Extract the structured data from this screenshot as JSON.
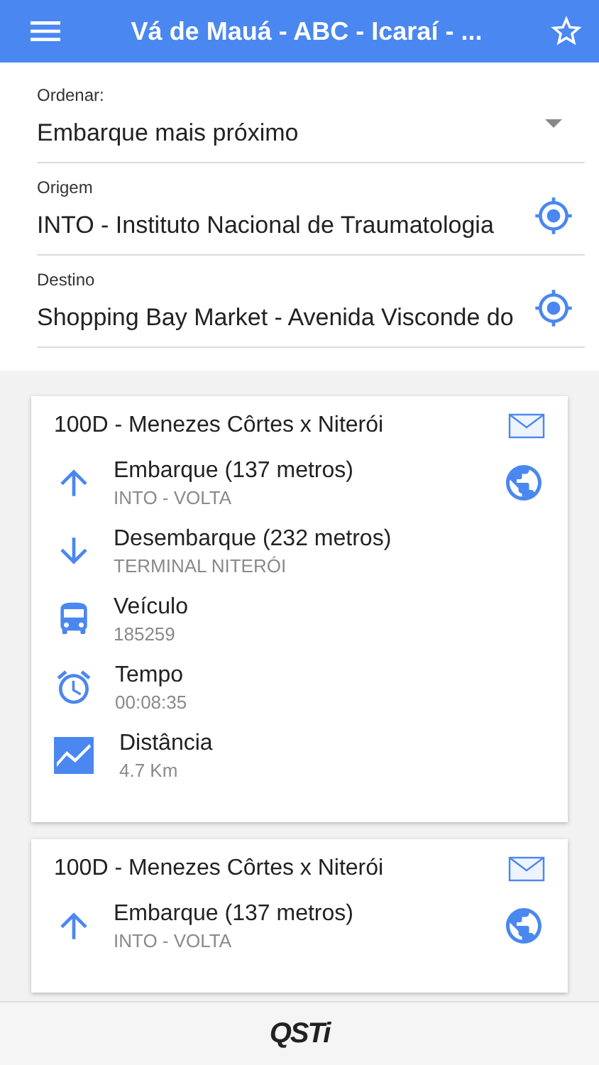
{
  "app_bar": {
    "title": "Vá de Mauá - ABC - Icaraí - ..."
  },
  "form": {
    "sort": {
      "label": "Ordenar:",
      "value": "Embarque mais próximo"
    },
    "fields": [
      {
        "label": "Origem",
        "value": "INTO - Instituto Nacional de Traumatologia"
      },
      {
        "label": "Destino",
        "value": "Shopping Bay Market - Avenida Visconde do"
      }
    ]
  },
  "cards": [
    {
      "title": "100D - Menezes Côrtes x Niterói",
      "rows": [
        {
          "kind": "board",
          "title": "Embarque (137 metros)",
          "detail": "INTO - VOLTA"
        },
        {
          "kind": "alight",
          "title": "Desembarque (232 metros)",
          "detail": "TERMINAL NITERÓI"
        },
        {
          "kind": "vehicle",
          "title": "Veículo",
          "detail": "185259"
        },
        {
          "kind": "time",
          "title": "Tempo",
          "detail": "00:08:35"
        },
        {
          "kind": "distance",
          "title": "Distância",
          "detail": "4.7  Km"
        }
      ]
    },
    {
      "title": "100D - Menezes Côrtes x Niterói",
      "rows": [
        {
          "kind": "board",
          "title": "Embarque (137 metros)",
          "detail": "INTO - VOLTA"
        }
      ]
    }
  ],
  "footer": {
    "logo": "QSTi"
  }
}
